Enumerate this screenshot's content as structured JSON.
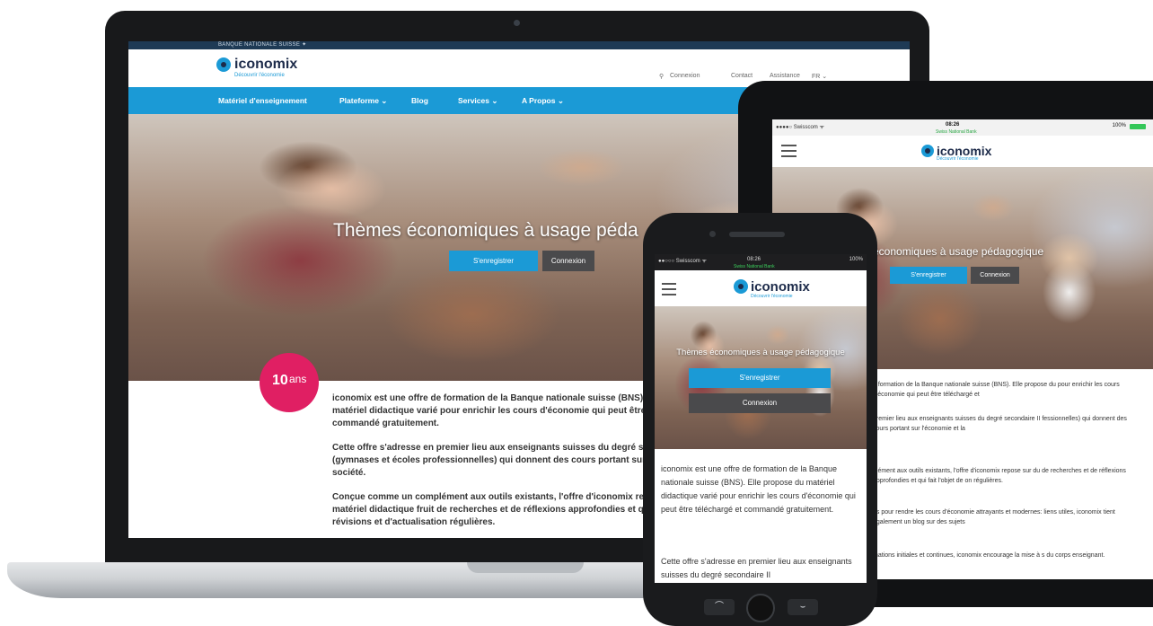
{
  "brand": {
    "name": "iconomix",
    "tagline": "Découvrir l'économie",
    "accent": "#1b9ad6",
    "navy": "#1d2b4a",
    "badge_color": "#e01f63"
  },
  "laptop": {
    "topbar": "BANQUE NATIONALE SUISSE ✦",
    "utility": {
      "search_icon": "magnifier-icon",
      "login": "Connexion",
      "contact": "Contact",
      "assistance": "Assistance",
      "language": "FR ⌄"
    },
    "nav": [
      {
        "label": "Matériel d'enseignement"
      },
      {
        "label": "Plateforme ⌄"
      },
      {
        "label": "Blog"
      },
      {
        "label": "Services ⌄"
      },
      {
        "label": "A Propos ⌄"
      }
    ],
    "hero": {
      "headline": "Thèmes économiques à usage péda",
      "register": "S'enregistrer",
      "login": "Connexion"
    },
    "badge": {
      "number": "10",
      "label": "ans"
    },
    "paragraphs": [
      "iconomix est une offre de formation de la Banque nationale suisse (BNS). matériel didactique varié pour enrichir les cours d'économie qui peut être commandé gratuitement.",
      "Cette offre s'adresse en premier lieu aux enseignants suisses du degré sec (gymnases et écoles professionnelles) qui donnent des cours portant sur l' société.",
      "Conçue comme un complément aux outils existants, l'offre d'iconomix repo matériel didactique fruit de recherches et de réflexions approfondies et qui révisions et d'actualisation régulières."
    ]
  },
  "tablet": {
    "status": {
      "carrier": "●●●●○ Swisscom ᯤ",
      "time": "08:26",
      "bank": "Swiss National Bank",
      "battery": "100%"
    },
    "hero": {
      "headline": "économiques à usage pédagogique",
      "register": "S'enregistrer",
      "login": "Connexion"
    },
    "paragraphs": [
      "e formation de la Banque nationale suisse (BNS). Elle propose du pour enrichir les cours d'économie qui peut être téléchargé et",
      "premier lieu aux enseignants suisses du degré secondaire II fessionnelles) qui donnent des cours portant sur l'économie et la",
      "plément aux outils existants, l'offre d'iconomix repose sur du de recherches et de réflexions approfondies et qui fait l'objet de on régulières.",
      "es pour rendre les cours d'économie attrayants et modernes: liens utiles, iconomix tient également un blog sur des sujets",
      "mations initiales et continues, iconomix encourage la mise à s du corps enseignant."
    ]
  },
  "phone": {
    "status": {
      "carrier": "●●○○○ Swisscom ᯤ",
      "time": "08:26",
      "bank": "Swiss National Bank",
      "battery": "100%"
    },
    "hero": {
      "headline": "Thèmes économiques à usage pédagogique",
      "register": "S'enregistrer",
      "login": "Connexion"
    },
    "paragraphs": [
      "iconomix est une offre de formation de la Banque nationale suisse (BNS). Elle propose du matériel didactique varié pour enrichir les cours d'économie qui peut être téléchargé et commandé gratuitement.",
      "Cette offre s'adresse en premier lieu aux enseignants suisses du degré secondaire II"
    ],
    "hardware": {
      "back": "⌒",
      "menu": "⌣"
    }
  }
}
